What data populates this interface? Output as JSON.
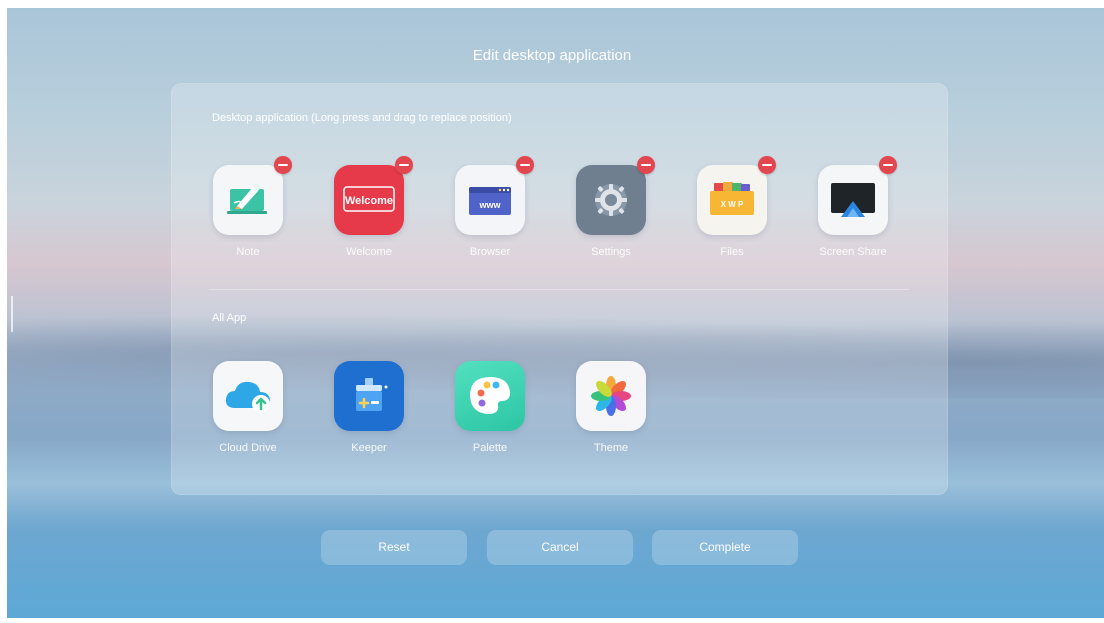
{
  "title": "Edit desktop application",
  "desktop_section": {
    "label": "Desktop application  (Long press and drag to replace position)",
    "apps": [
      {
        "label": "Note",
        "icon": "note-icon"
      },
      {
        "label": "Welcome",
        "icon": "welcome-icon",
        "icon_text": "Welcome"
      },
      {
        "label": "Browser",
        "icon": "browser-icon",
        "icon_text": "www"
      },
      {
        "label": "Settings",
        "icon": "settings-icon"
      },
      {
        "label": "Files",
        "icon": "files-icon",
        "icon_text": "X W P"
      },
      {
        "label": "Screen Share",
        "icon": "screen-share-icon"
      }
    ]
  },
  "all_section": {
    "label": "All App",
    "apps": [
      {
        "label": "Cloud Drive",
        "icon": "cloud-drive-icon"
      },
      {
        "label": "Keeper",
        "icon": "keeper-icon"
      },
      {
        "label": "Palette",
        "icon": "palette-icon"
      },
      {
        "label": "Theme",
        "icon": "theme-icon"
      }
    ]
  },
  "buttons": {
    "reset": "Reset",
    "cancel": "Cancel",
    "complete": "Complete"
  },
  "colors": {
    "remove_badge": "#e2474f",
    "welcome": "#e63a4a",
    "keeper": "#1f6fd1",
    "palette": "#3fd6b4",
    "settings": "#6f7f8f"
  }
}
